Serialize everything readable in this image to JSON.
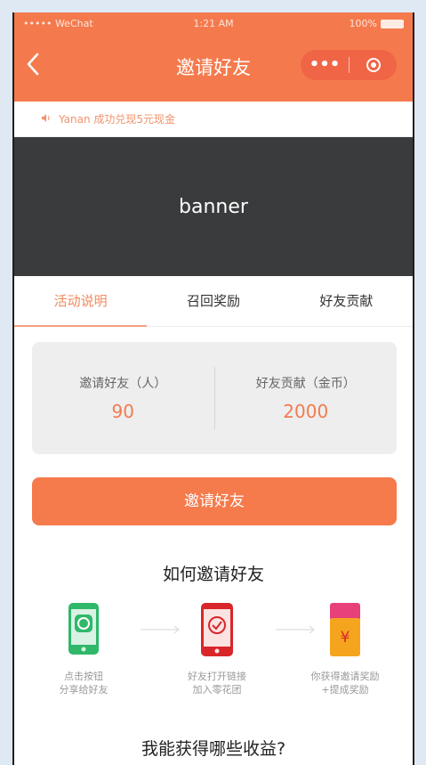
{
  "status_bar": {
    "carrier": "••••• WeChat ",
    "time": "1:21 AM",
    "battery": "100%"
  },
  "nav": {
    "back_icon": "chevron-left-icon",
    "title": "邀请好友",
    "more_label": "•••",
    "close_icon": "target-circle-icon",
    "bar_color": "#f47a4d"
  },
  "notice": {
    "icon": "speaker-icon",
    "text": "Yanan  成功兑现5元现金"
  },
  "banner": {
    "text": "banner"
  },
  "tabs": [
    {
      "label": "活动说明",
      "active": true
    },
    {
      "label": "召回奖励",
      "active": false
    },
    {
      "label": "好友贡献",
      "active": false
    }
  ],
  "stats": {
    "invited_label": "邀请好友（人）",
    "invited_value": "90",
    "contribution_label": "好友贡献（金币）",
    "contribution_value": "2000"
  },
  "invite_button": {
    "label": "邀请好友",
    "color": "#f57a4c"
  },
  "how_section": {
    "title": "如何邀请好友",
    "steps": [
      {
        "icon": "wechat-phone-icon",
        "line1": "点击按钮",
        "line2": "分享给好友"
      },
      {
        "icon": "checked-phone-icon",
        "line1": "好友打开链接",
        "line2": "加入零花团"
      },
      {
        "icon": "red-envelope-icon",
        "line1": "你获得邀请奖励",
        "line2": "+提成奖励"
      }
    ]
  },
  "earn_section": {
    "title": "我能获得哪些收益?"
  }
}
